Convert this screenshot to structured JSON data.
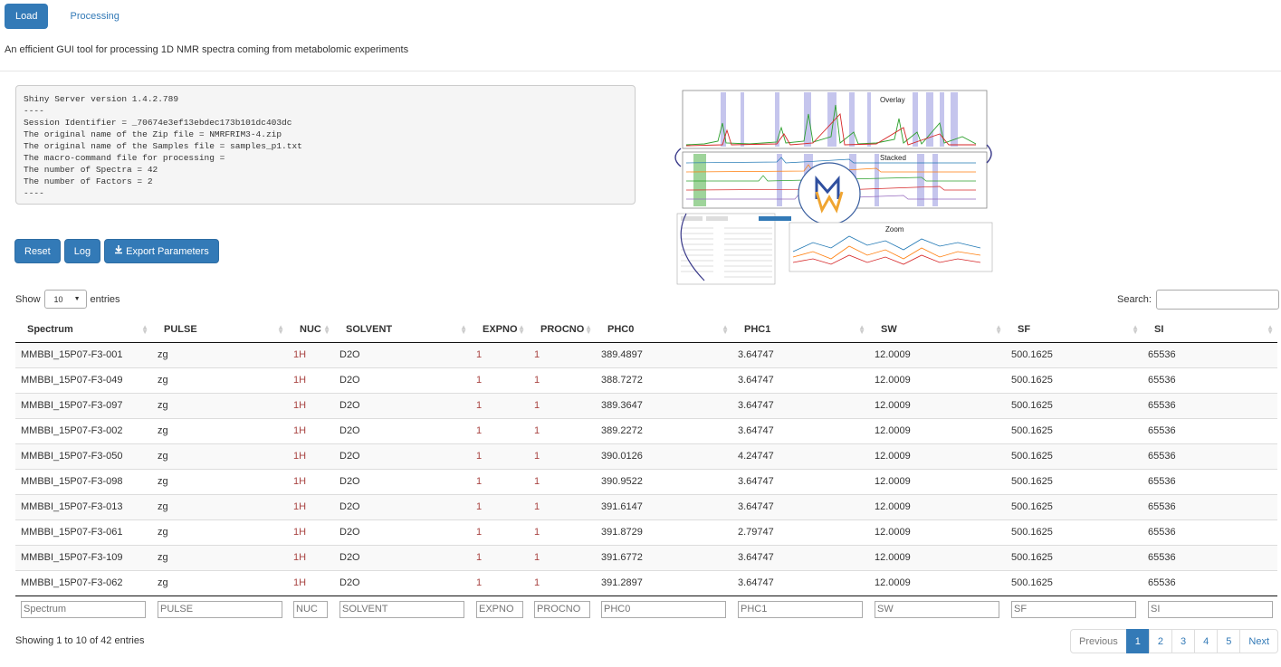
{
  "tabs": [
    {
      "label": "Load"
    },
    {
      "label": "Processing"
    }
  ],
  "subtitle": "An efficient GUI tool for processing 1D NMR spectra coming from metabolomic experiments",
  "server_info": "Shiny Server version 1.4.2.789\n----\nSession Identifier = _70674e3ef13ebdec173b101dc403dc\nThe original name of the Zip file = NMRFRIM3-4.zip\nThe original name of the Samples file = samples_p1.txt\nThe macro-command file for processing =\nThe number of Spectra = 42\nThe number of Factors = 2\n----",
  "buttons": {
    "reset": "Reset",
    "log": "Log",
    "export": "Export Parameters"
  },
  "thumbnail": {
    "overlay": "Overlay",
    "stacked": "Stacked",
    "zoom": "Zoom"
  },
  "length_menu": {
    "show": "Show",
    "value": "10",
    "entries": "entries"
  },
  "search": {
    "label": "Search:",
    "value": ""
  },
  "columns": [
    "Spectrum",
    "PULSE",
    "NUC",
    "SOLVENT",
    "EXPNO",
    "PROCNO",
    "PHC0",
    "PHC1",
    "SW",
    "SF",
    "SI"
  ],
  "rows": [
    [
      "MMBBI_15P07-F3-001",
      "zg",
      "1H",
      "D2O",
      "1",
      "1",
      "389.4897",
      "3.64747",
      "12.0009",
      "500.1625",
      "65536"
    ],
    [
      "MMBBI_15P07-F3-049",
      "zg",
      "1H",
      "D2O",
      "1",
      "1",
      "388.7272",
      "3.64747",
      "12.0009",
      "500.1625",
      "65536"
    ],
    [
      "MMBBI_15P07-F3-097",
      "zg",
      "1H",
      "D2O",
      "1",
      "1",
      "389.3647",
      "3.64747",
      "12.0009",
      "500.1625",
      "65536"
    ],
    [
      "MMBBI_15P07-F3-002",
      "zg",
      "1H",
      "D2O",
      "1",
      "1",
      "389.2272",
      "3.64747",
      "12.0009",
      "500.1625",
      "65536"
    ],
    [
      "MMBBI_15P07-F3-050",
      "zg",
      "1H",
      "D2O",
      "1",
      "1",
      "390.0126",
      "4.24747",
      "12.0009",
      "500.1625",
      "65536"
    ],
    [
      "MMBBI_15P07-F3-098",
      "zg",
      "1H",
      "D2O",
      "1",
      "1",
      "390.9522",
      "3.64747",
      "12.0009",
      "500.1625",
      "65536"
    ],
    [
      "MMBBI_15P07-F3-013",
      "zg",
      "1H",
      "D2O",
      "1",
      "1",
      "391.6147",
      "3.64747",
      "12.0009",
      "500.1625",
      "65536"
    ],
    [
      "MMBBI_15P07-F3-061",
      "zg",
      "1H",
      "D2O",
      "1",
      "1",
      "391.8729",
      "2.79747",
      "12.0009",
      "500.1625",
      "65536"
    ],
    [
      "MMBBI_15P07-F3-109",
      "zg",
      "1H",
      "D2O",
      "1",
      "1",
      "391.6772",
      "3.64747",
      "12.0009",
      "500.1625",
      "65536"
    ],
    [
      "MMBBI_15P07-F3-062",
      "zg",
      "1H",
      "D2O",
      "1",
      "1",
      "391.2897",
      "3.64747",
      "12.0009",
      "500.1625",
      "65536"
    ]
  ],
  "info_text": "Showing 1 to 10 of 42 entries",
  "pagination": {
    "previous": "Previous",
    "pages": [
      "1",
      "2",
      "3",
      "4",
      "5"
    ],
    "next": "Next",
    "current": "1"
  }
}
